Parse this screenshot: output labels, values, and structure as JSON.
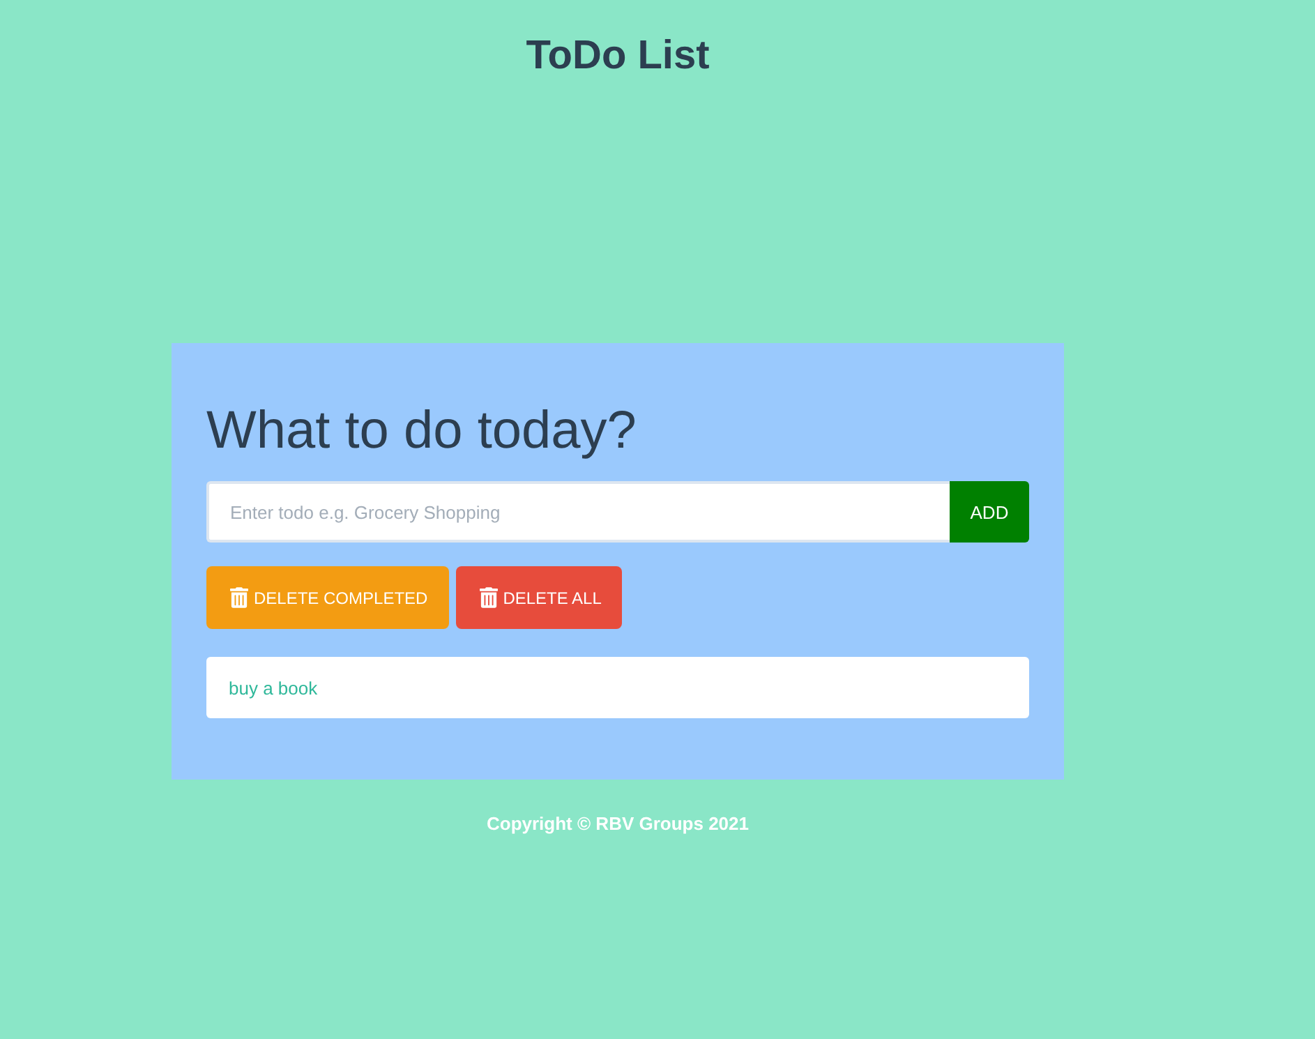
{
  "title": "ToDo List",
  "card": {
    "heading": "What to do today?",
    "input": {
      "placeholder": "Enter todo e.g. Grocery Shopping"
    },
    "add_button": "ADD",
    "actions": [
      {
        "label": "DELETE COMPLETED",
        "kind": "warning"
      },
      {
        "label": "DELETE ALL",
        "kind": "danger"
      }
    ],
    "todos": [
      {
        "text": "buy a book"
      }
    ]
  },
  "footer": "Copyright © RBV Groups 2021"
}
